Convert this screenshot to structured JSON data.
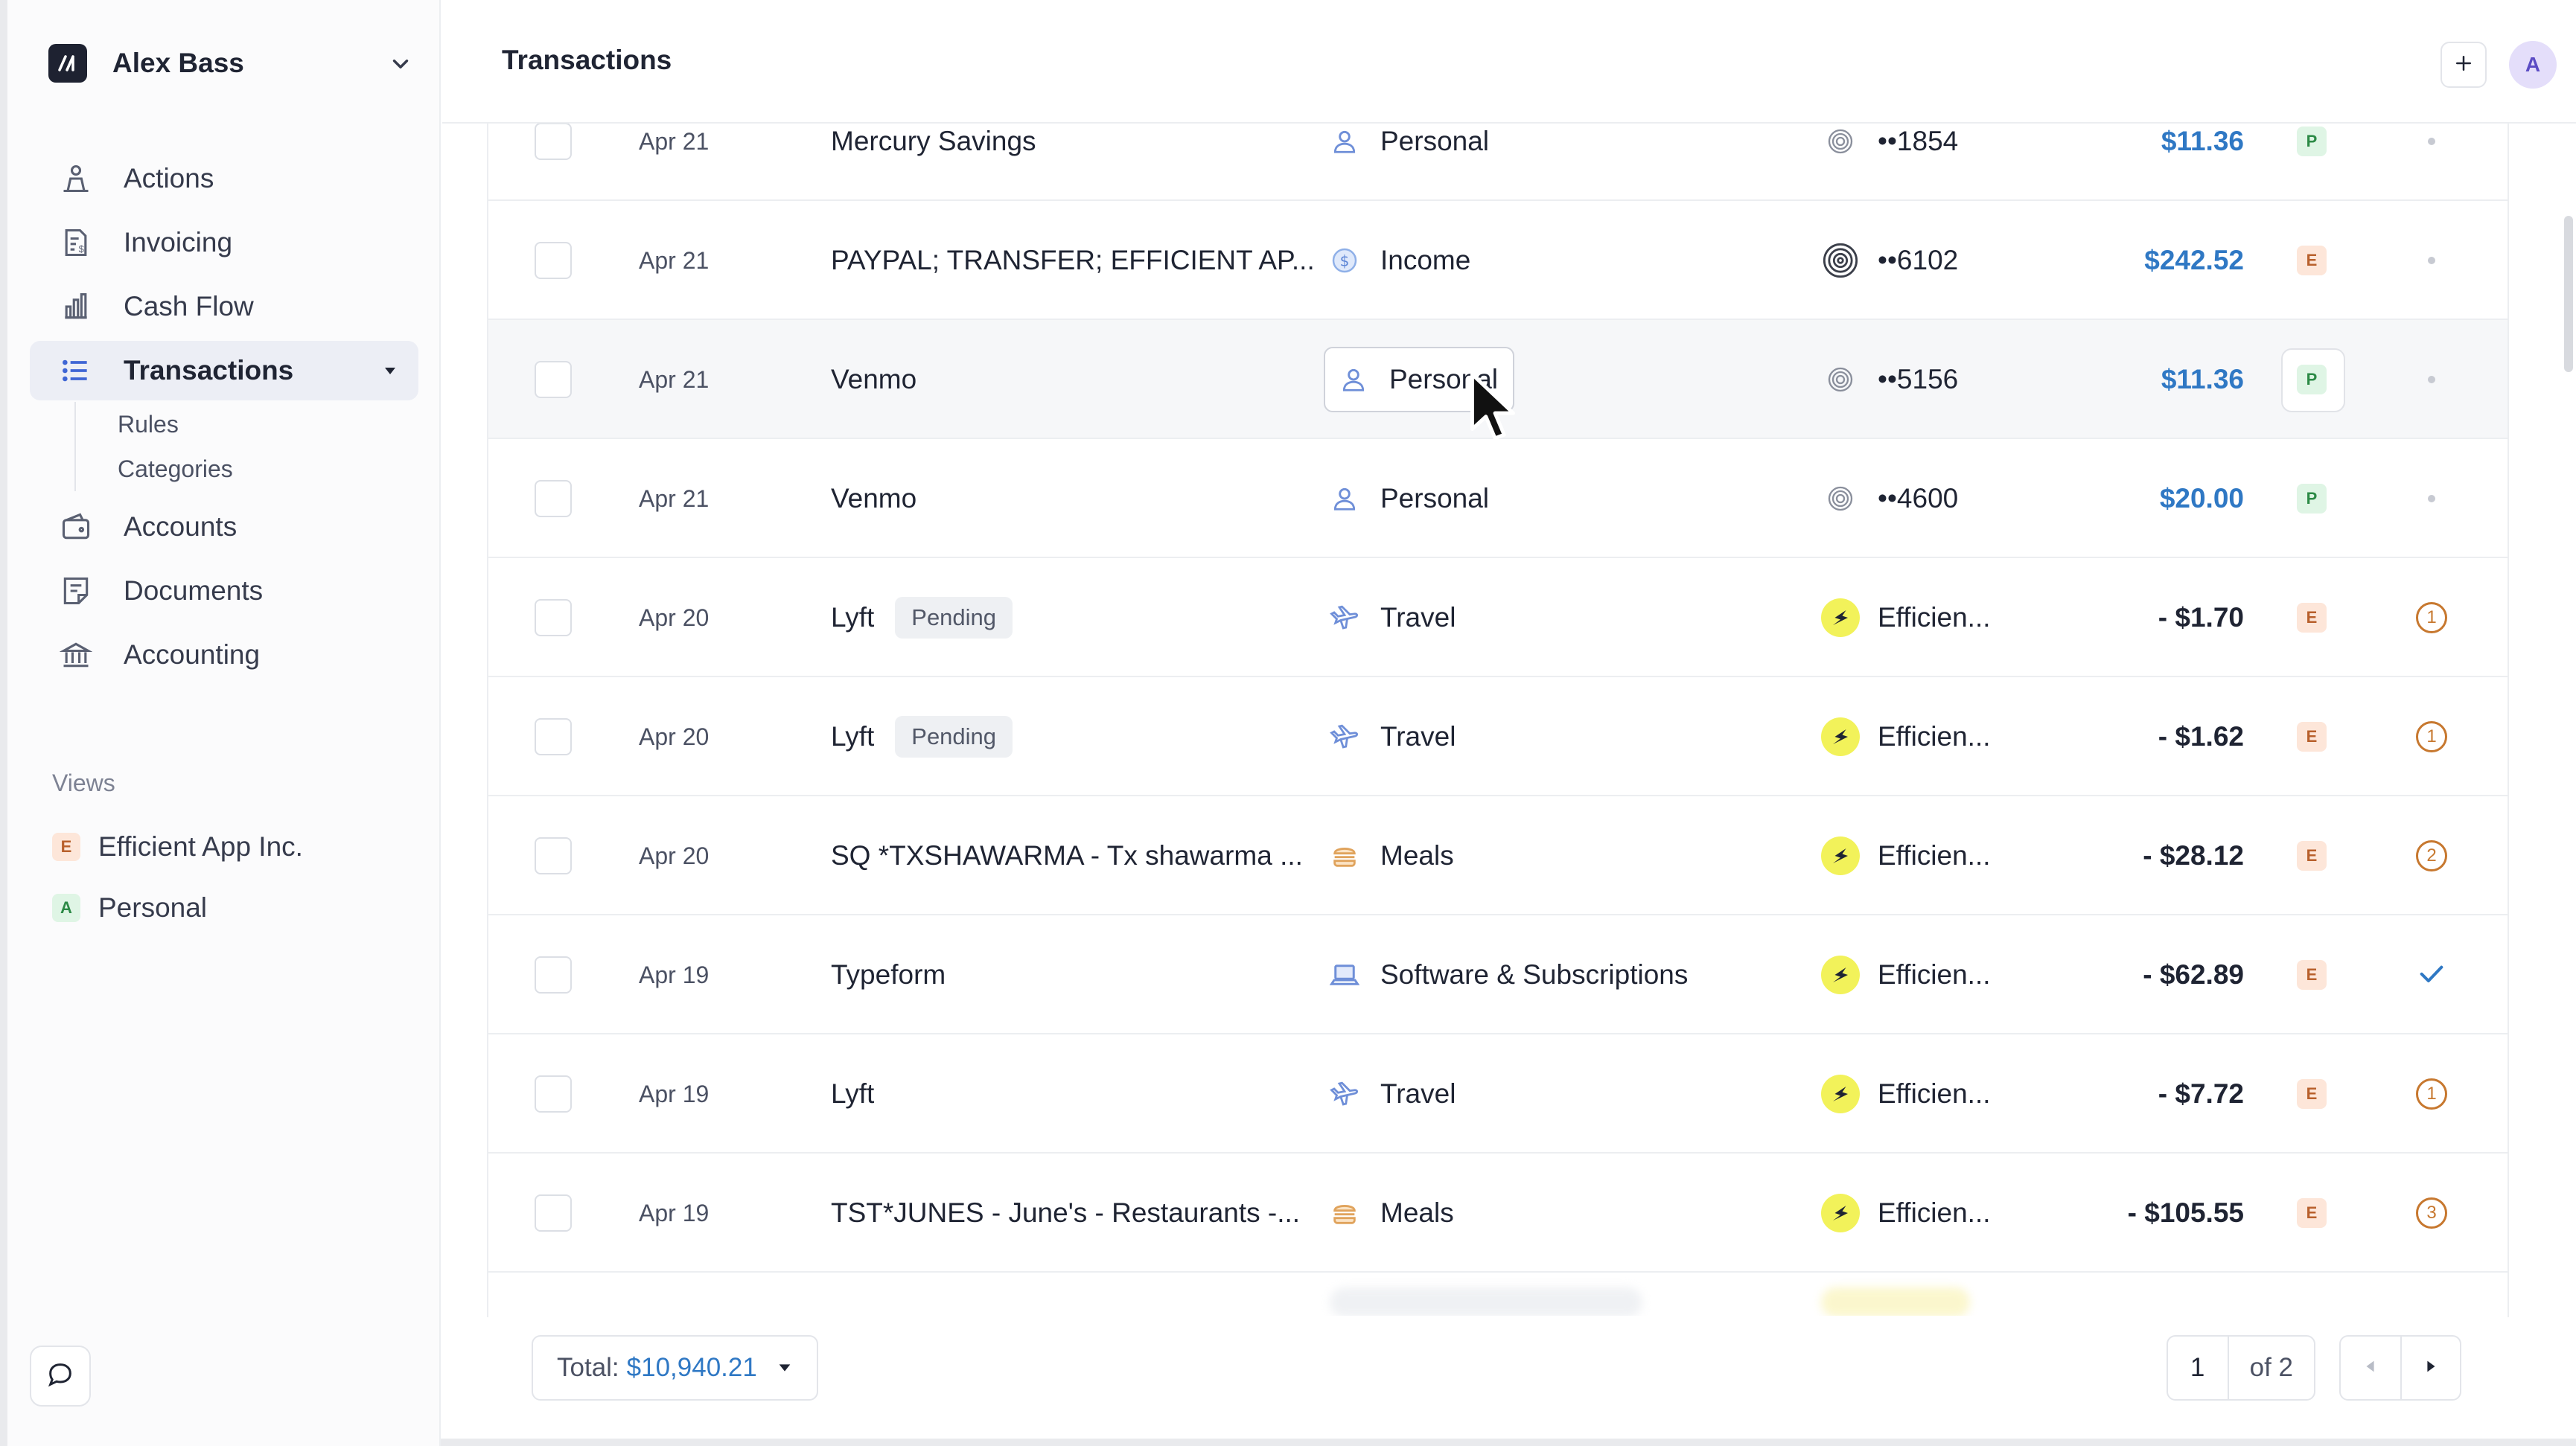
{
  "sidebar": {
    "org_name": "Alex Bass",
    "nav": [
      {
        "label": "Actions",
        "icon": "actions-icon"
      },
      {
        "label": "Invoicing",
        "icon": "invoice-icon"
      },
      {
        "label": "Cash Flow",
        "icon": "bar-chart-icon"
      },
      {
        "label": "Transactions",
        "icon": "list-icon",
        "active": true
      },
      {
        "label": "Accounts",
        "icon": "wallet-icon"
      },
      {
        "label": "Documents",
        "icon": "document-icon"
      },
      {
        "label": "Accounting",
        "icon": "bank-icon"
      }
    ],
    "subnav": [
      "Rules",
      "Categories"
    ],
    "views_title": "Views",
    "views": [
      {
        "badge": "E",
        "label": "Efficient App Inc.",
        "color": "#fde6d9"
      },
      {
        "badge": "A",
        "label": "Personal",
        "color": "#dff5e5"
      }
    ]
  },
  "header": {
    "title": "Transactions",
    "avatar": "A"
  },
  "transactions": [
    {
      "date": "Apr 21",
      "description": "Mercury Savings",
      "pending": "",
      "category": "Personal",
      "account": "••1854",
      "amount": "$11.36",
      "entity": "P",
      "status": "dot"
    },
    {
      "date": "Apr 21",
      "description": "PAYPAL; TRANSFER; EFFICIENT AP...",
      "pending": "",
      "category": "Income",
      "account": "••6102",
      "amount": "$242.52",
      "entity": "E",
      "status": "dot"
    },
    {
      "date": "Apr 21",
      "description": "Venmo",
      "pending": "",
      "category": "Personal",
      "account": "••5156",
      "amount": "$11.36",
      "entity": "P",
      "status": "dot"
    },
    {
      "date": "Apr 21",
      "description": "Venmo",
      "pending": "",
      "category": "Personal",
      "account": "••4600",
      "amount": "$20.00",
      "entity": "P",
      "status": "dot"
    },
    {
      "date": "Apr 20",
      "description": "Lyft",
      "pending": "Pending",
      "category": "Travel",
      "account": "Efficien...",
      "amount": "- $1.70",
      "entity": "E",
      "status": "1"
    },
    {
      "date": "Apr 20",
      "description": "Lyft",
      "pending": "Pending",
      "category": "Travel",
      "account": "Efficien...",
      "amount": "- $1.62",
      "entity": "E",
      "status": "1"
    },
    {
      "date": "Apr 20",
      "description": "SQ *TXSHAWARMA - Tx shawarma ...",
      "pending": "",
      "category": "Meals",
      "account": "Efficien...",
      "amount": "- $28.12",
      "entity": "E",
      "status": "2"
    },
    {
      "date": "Apr 19",
      "description": "Typeform",
      "pending": "",
      "category": "Software & Subscriptions",
      "account": "Efficien...",
      "amount": "- $62.89",
      "entity": "E",
      "status": "check"
    },
    {
      "date": "Apr 19",
      "description": "Lyft",
      "pending": "",
      "category": "Travel",
      "account": "Efficien...",
      "amount": "- $7.72",
      "entity": "E",
      "status": "1"
    },
    {
      "date": "Apr 19",
      "description": "TST*JUNES - June's - Restaurants -...",
      "pending": "",
      "category": "Meals",
      "account": "Efficien...",
      "amount": "- $105.55",
      "entity": "E",
      "status": "3"
    }
  ],
  "footer": {
    "total_label": "Total:",
    "total_value": "$10,940.21",
    "page": "1",
    "of_pages": "of 2"
  },
  "colors": {
    "accent_blue": "#2f78c4",
    "receipt_orange": "#c7782f",
    "check_blue": "#2f78c4"
  }
}
